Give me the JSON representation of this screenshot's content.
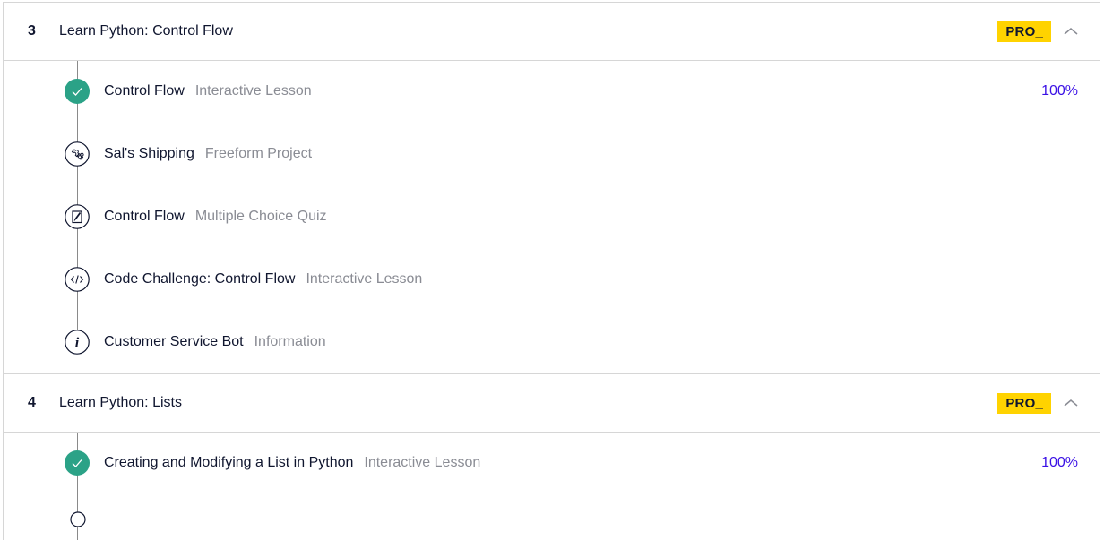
{
  "modules": [
    {
      "number": "3",
      "title": "Learn Python: Control Flow",
      "badge": "PRO_",
      "items": [
        {
          "name": "Control Flow",
          "type": "Interactive Lesson",
          "icon": "check-icon",
          "progress": "100%"
        },
        {
          "name": "Sal's Shipping",
          "type": "Freeform Project",
          "icon": "puzzle-icon",
          "progress": ""
        },
        {
          "name": "Control Flow",
          "type": "Multiple Choice Quiz",
          "icon": "quiz-icon",
          "progress": ""
        },
        {
          "name": "Code Challenge: Control Flow",
          "type": "Interactive Lesson",
          "icon": "code-icon",
          "progress": ""
        },
        {
          "name": "Customer Service Bot",
          "type": "Information",
          "icon": "info-icon",
          "progress": ""
        }
      ]
    },
    {
      "number": "4",
      "title": "Learn Python: Lists",
      "badge": "PRO_",
      "items": [
        {
          "name": "Creating and Modifying a List in Python",
          "type": "Interactive Lesson",
          "icon": "check-icon",
          "progress": "100%"
        }
      ]
    }
  ],
  "colors": {
    "complete": "#2ba287",
    "progress_text": "#3a10e5",
    "pro_badge": "#ffd300"
  }
}
